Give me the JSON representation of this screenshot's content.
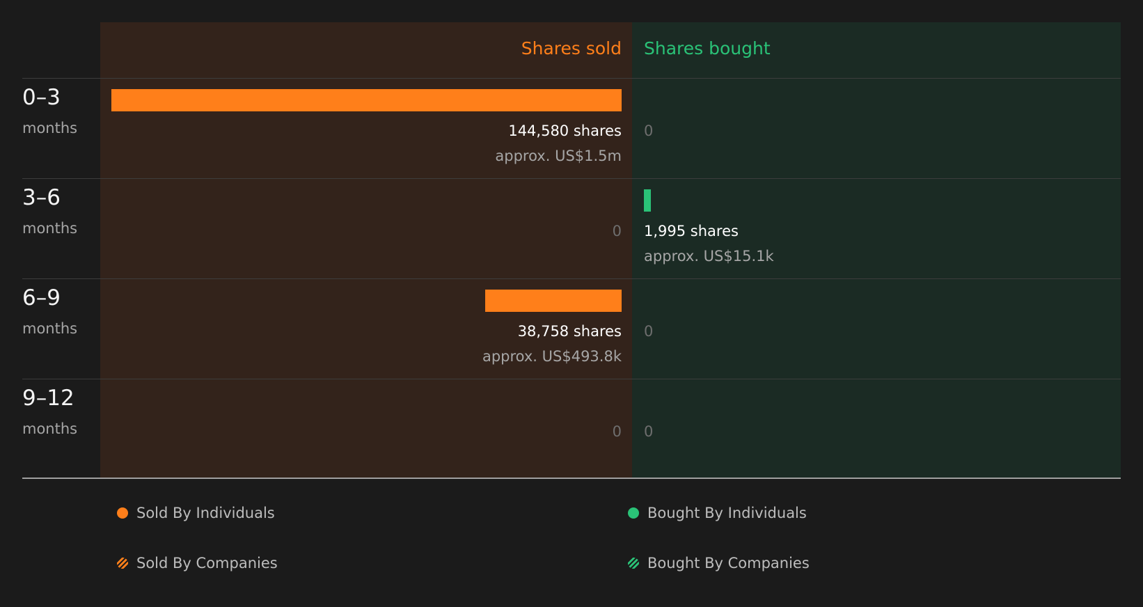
{
  "chart_data": {
    "type": "bar",
    "headers": {
      "sold": "Shares sold",
      "bought": "Shares bought"
    },
    "colors": {
      "sold": "#ff7f1a",
      "bought": "#2ac277"
    },
    "max_shares": 144580,
    "periods": [
      {
        "range": "0–3",
        "unit": "months",
        "sold_shares": 144580,
        "sold_label": "144,580 shares",
        "sold_value": "approx. US$1.5m",
        "bought_shares": 0,
        "bought_label": "0",
        "bought_value": ""
      },
      {
        "range": "3–6",
        "unit": "months",
        "sold_shares": 0,
        "sold_label": "0",
        "sold_value": "",
        "bought_shares": 1995,
        "bought_label": "1,995 shares",
        "bought_value": "approx. US$15.1k"
      },
      {
        "range": "6–9",
        "unit": "months",
        "sold_shares": 38758,
        "sold_label": "38,758 shares",
        "sold_value": "approx. US$493.8k",
        "bought_shares": 0,
        "bought_label": "0",
        "bought_value": ""
      },
      {
        "range": "9–12",
        "unit": "months",
        "sold_shares": 0,
        "sold_label": "0",
        "sold_value": "",
        "bought_shares": 0,
        "bought_label": "0",
        "bought_value": ""
      }
    ],
    "legend": [
      {
        "label": "Sold By Individuals",
        "color": "#ff7f1a",
        "pattern": "solid"
      },
      {
        "label": "Bought By Individuals",
        "color": "#2ac277",
        "pattern": "solid"
      },
      {
        "label": "Sold By Companies",
        "color": "#ff7f1a",
        "pattern": "hatched"
      },
      {
        "label": "Bought By Companies",
        "color": "#2ac277",
        "pattern": "hatched"
      }
    ]
  }
}
